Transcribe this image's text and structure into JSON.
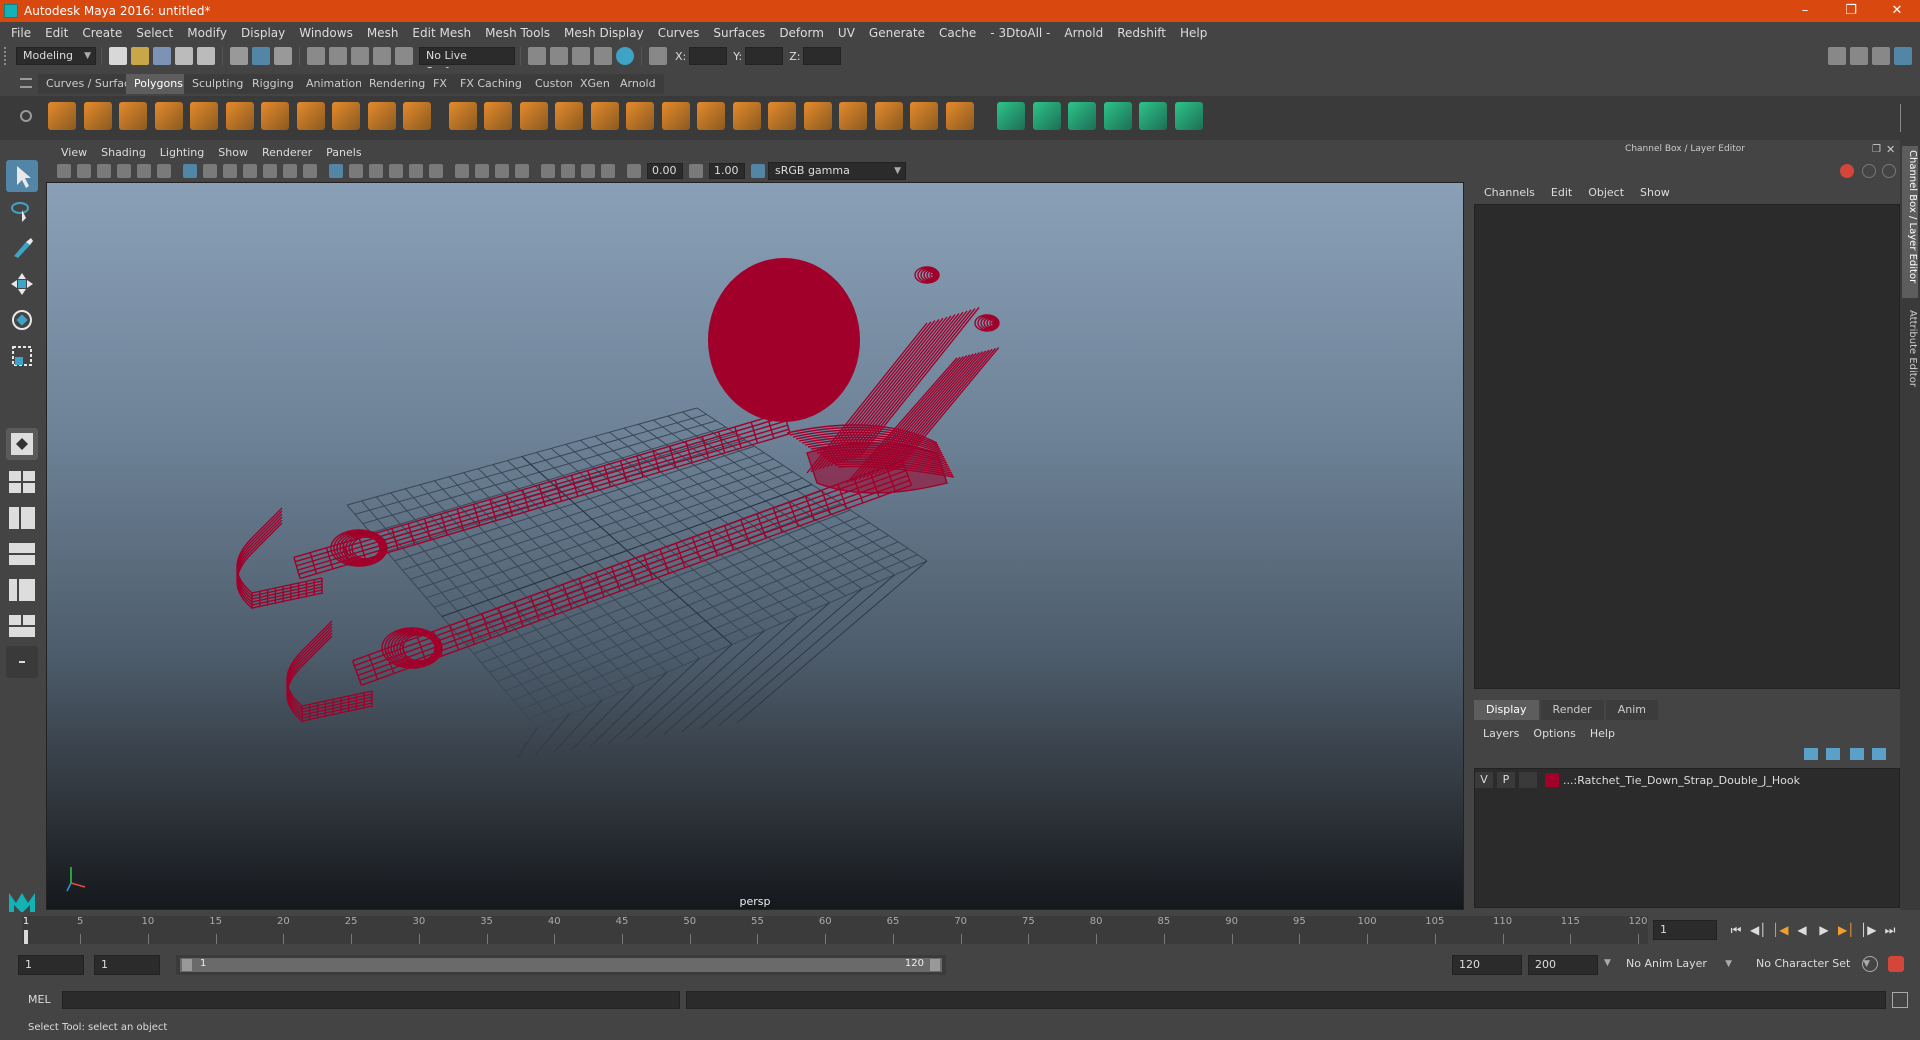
{
  "window": {
    "title": "Autodesk Maya 2016: untitled*"
  },
  "menubar": [
    "File",
    "Edit",
    "Create",
    "Select",
    "Modify",
    "Display",
    "Windows",
    "Mesh",
    "Edit Mesh",
    "Mesh Tools",
    "Mesh Display",
    "Curves",
    "Surfaces",
    "Deform",
    "UV",
    "Generate",
    "Cache",
    "- 3DtoAll -",
    "Arnold",
    "Redshift",
    "Help"
  ],
  "statusline": {
    "menuset": "Modeling",
    "live_surface": "No Live Surface",
    "x_label": "X:",
    "y_label": "Y:",
    "z_label": "Z:"
  },
  "shelf_tabs": [
    "Curves / Surfaces",
    "Polygons",
    "Sculpting",
    "Rigging",
    "Animation",
    "Rendering",
    "FX",
    "FX Caching",
    "Custom",
    "XGen",
    "Arnold"
  ],
  "shelf_active": "Polygons",
  "viewport": {
    "menus": [
      "View",
      "Shading",
      "Lighting",
      "Show",
      "Renderer",
      "Panels"
    ],
    "exposure": "0.00",
    "gamma": "1.00",
    "color_space": "sRGB gamma",
    "camera_label": "persp"
  },
  "channel_box": {
    "title": "Channel Box / Layer Editor",
    "menus": [
      "Channels",
      "Edit",
      "Object",
      "Show"
    ]
  },
  "layer_editor": {
    "tabs": [
      "Display",
      "Render",
      "Anim"
    ],
    "active_tab": "Display",
    "menus": [
      "Layers",
      "Options",
      "Help"
    ],
    "layers": [
      {
        "v": "V",
        "p": "P",
        "color": "#a0002a",
        "name": "...:Ratchet_Tie_Down_Strap_Double_J_Hook"
      }
    ]
  },
  "side_tabs": [
    "Channel Box / Layer Editor",
    "Attribute Editor"
  ],
  "timeline": {
    "tick_labels": [
      "1",
      "5",
      "10",
      "15",
      "20",
      "25",
      "30",
      "35",
      "40",
      "45",
      "50",
      "55",
      "60",
      "65",
      "70",
      "75",
      "80",
      "85",
      "90",
      "95",
      "100",
      "105",
      "110",
      "115",
      "120"
    ],
    "current_frame": "1"
  },
  "range": {
    "start": "1",
    "playback_start": "1",
    "range_start_label": "1",
    "range_end_label": "120",
    "playback_end": "120",
    "end": "200",
    "anim_layer": "No Anim Layer",
    "character_set": "No Character Set"
  },
  "cmdline": {
    "label": "MEL"
  },
  "helpline": {
    "text": "Select Tool: select an object"
  },
  "colors": {
    "title_bar": "#d9480f",
    "mesh": "#a0002a",
    "accent": "#5285a6"
  }
}
